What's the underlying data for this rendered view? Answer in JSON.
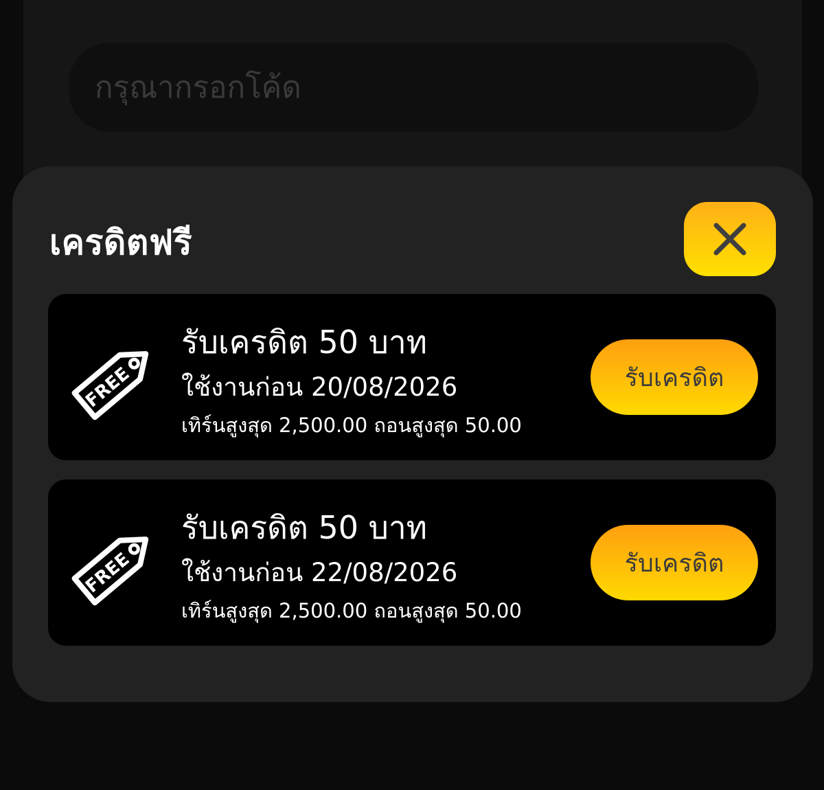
{
  "code_input": {
    "placeholder": "กรุณากรอกโค้ด",
    "value": ""
  },
  "modal": {
    "title": "เครดิตฟรี",
    "close_icon": "close-icon",
    "colors": {
      "accent_top": "#ffb016",
      "accent_bottom": "#ffe000",
      "card_bg": "#000000",
      "modal_bg": "#222222"
    },
    "credits": [
      {
        "icon": "free-tag-icon",
        "tag_text": "FREE",
        "title": "รับเครดิต 50 บาท",
        "expiry": "ใช้งานก่อน 20/08/2026",
        "limits": "เทิร์นสูงสุด 2,500.00 ถอนสูงสุด 50.00",
        "button_label": "รับเครดิต"
      },
      {
        "icon": "free-tag-icon",
        "tag_text": "FREE",
        "title": "รับเครดิต 50 บาท",
        "expiry": "ใช้งานก่อน 22/08/2026",
        "limits": "เทิร์นสูงสุด 2,500.00 ถอนสูงสุด 50.00",
        "button_label": "รับเครดิต"
      }
    ]
  }
}
